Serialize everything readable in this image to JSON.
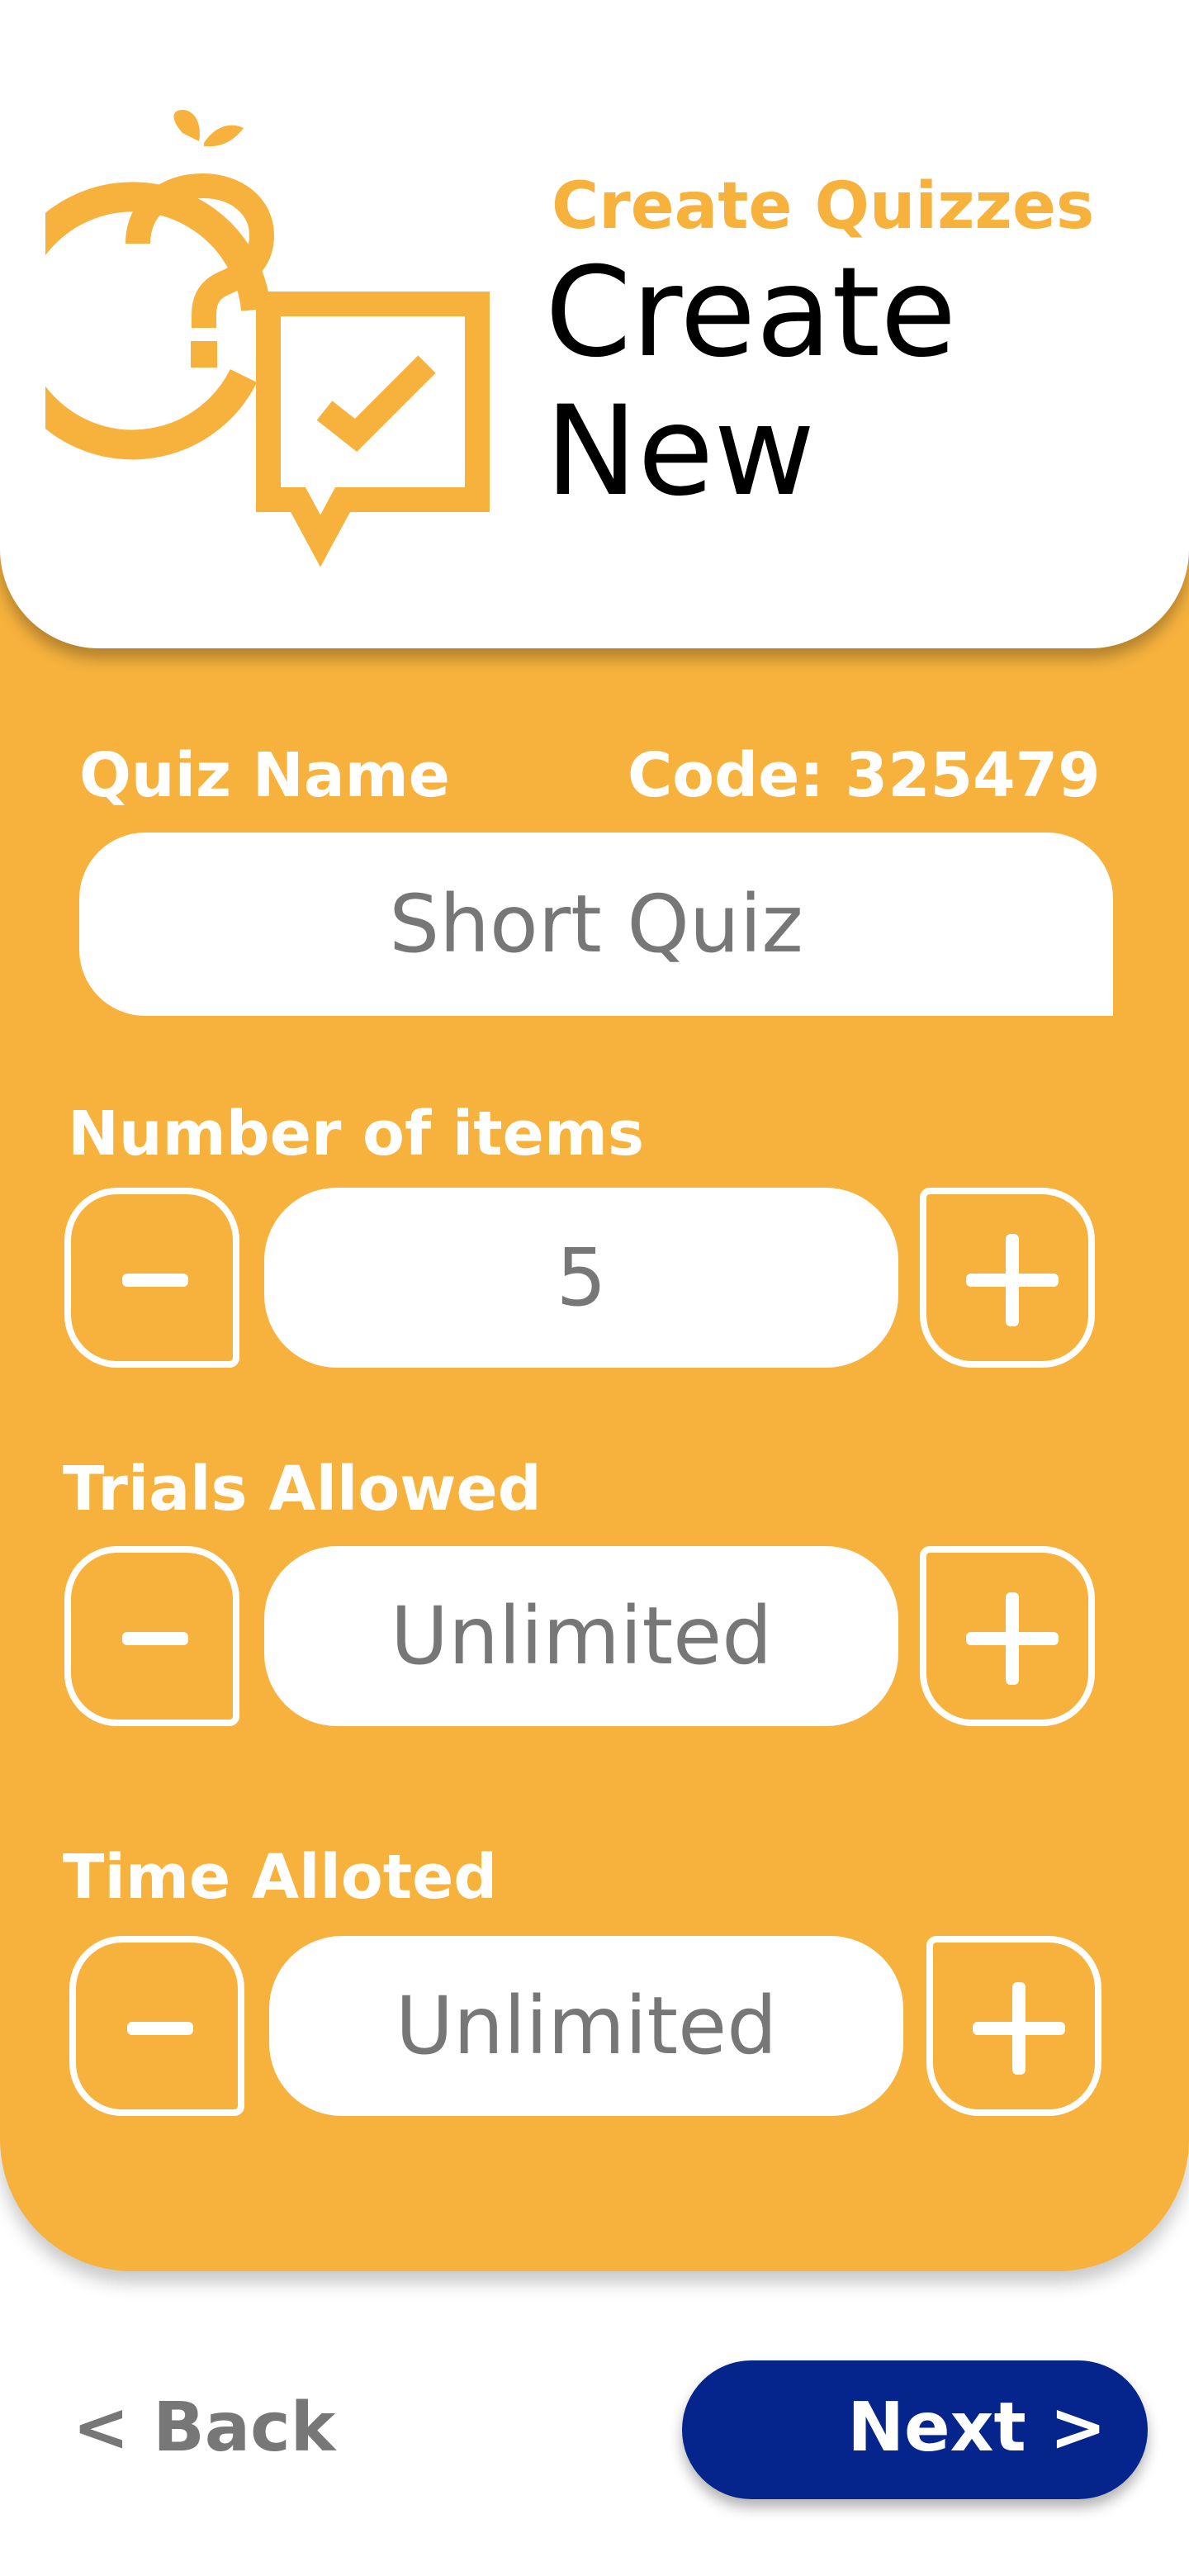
{
  "header": {
    "subtitle": "Create Quizzes",
    "title_line1": "Create",
    "title_line2": "New"
  },
  "quiz_name": {
    "label": "Quiz Name",
    "code_label": "Code: 325479",
    "value": "Short Quiz"
  },
  "number_of_items": {
    "label": "Number of items",
    "value": "5"
  },
  "trials_allowed": {
    "label": "Trials Allowed",
    "value": "Unlimited"
  },
  "time_alloted": {
    "label": "Time Alloted",
    "value": "Unlimited"
  },
  "footer": {
    "back_label": "< Back",
    "next_label": "Next >"
  },
  "colors": {
    "accent": "#F6B23D",
    "primary_button": "#05258C",
    "muted_text": "#777777"
  },
  "icons": [
    "quiz-logo-icon",
    "minus-icon",
    "plus-icon"
  ]
}
